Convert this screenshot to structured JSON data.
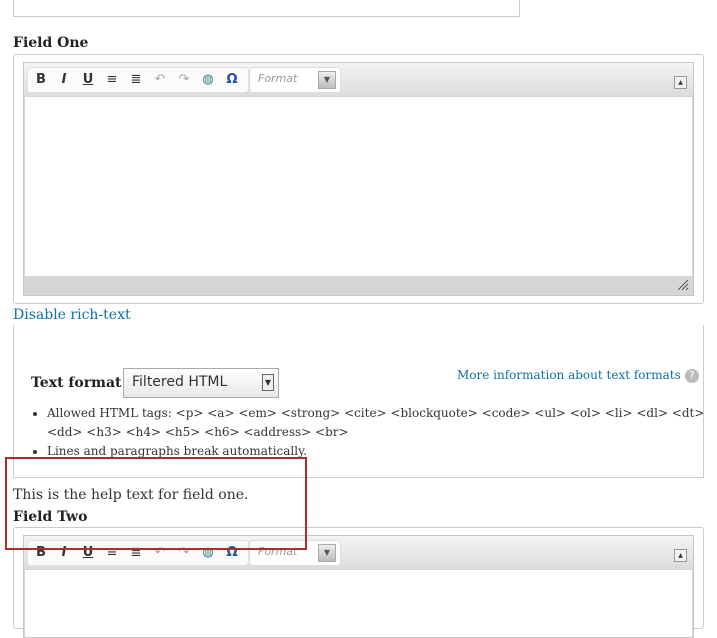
{
  "field_one": {
    "label": "Field One",
    "toolbar": {
      "buttons": [
        {
          "name": "bold-icon",
          "glyph": "B"
        },
        {
          "name": "italic-icon",
          "glyph": "I"
        },
        {
          "name": "underline-icon",
          "glyph": "U"
        },
        {
          "name": "bulleted-list-icon",
          "glyph": "≡"
        },
        {
          "name": "numbered-list-icon",
          "glyph": "≣"
        },
        {
          "name": "undo-icon",
          "glyph": "↶"
        },
        {
          "name": "redo-icon",
          "glyph": "↷"
        },
        {
          "name": "link-globe-icon",
          "glyph": "◍"
        },
        {
          "name": "special-char-icon",
          "glyph": "Ω"
        }
      ],
      "format_placeholder": "Format"
    },
    "disable_link": "Disable rich-text"
  },
  "text_format": {
    "label": "Text format",
    "selected": "Filtered HTML",
    "more_info_link": "More information about text formats",
    "tips": [
      "Allowed HTML tags: <p> <a> <em> <strong> <cite> <blockquote> <code> <ul> <ol> <li> <dl> <dt> <dd> <h3> <h4> <h5> <h6> <address> <br>",
      "Lines and paragraphs break automatically."
    ]
  },
  "help_text": "This is the help text for field one.",
  "field_two": {
    "label": "Field Two",
    "format_placeholder": "Format"
  },
  "colors": {
    "link": "#0f6fa8",
    "highlight_border": "#b22a2a"
  }
}
